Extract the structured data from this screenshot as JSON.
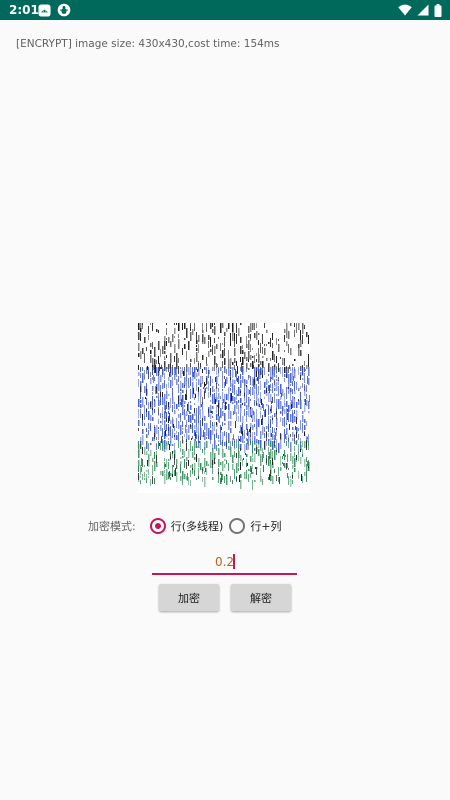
{
  "status_bar": {
    "time": "2:01",
    "background_color": "#00695c",
    "left_icons": [
      "android-icon",
      "bug-icon"
    ],
    "right_icons": [
      "wifi-icon",
      "signal-icon",
      "battery-icon"
    ]
  },
  "info": {
    "text": "[ENCRYPT] image size:  430x430,cost time:  154ms"
  },
  "image": {
    "description_colors": [
      "#1a1a1a",
      "#3f5bd0",
      "#2e8b57"
    ]
  },
  "mode": {
    "label": "加密模式:",
    "options": [
      {
        "label": "行(多线程)",
        "selected": true
      },
      {
        "label": "行+列",
        "selected": false
      }
    ],
    "accent_color": "#c2185b"
  },
  "input": {
    "value": "0.2"
  },
  "buttons": {
    "encrypt_label": "加密",
    "decrypt_label": "解密"
  }
}
